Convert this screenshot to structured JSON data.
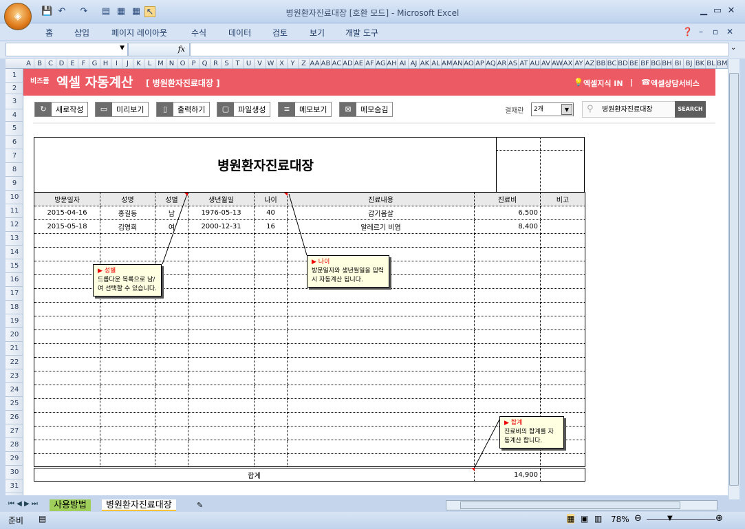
{
  "window": {
    "title": "병원환자진료대장  [호환 모드] - Microsoft Excel"
  },
  "ribbon": {
    "tabs": [
      "홈",
      "삽입",
      "페이지 레이아웃",
      "수식",
      "데이터",
      "검토",
      "보기",
      "개발 도구"
    ]
  },
  "formula": {
    "fx": "fx"
  },
  "columns": [
    "A",
    "B",
    "C",
    "D",
    "E",
    "F",
    "G",
    "H",
    "I",
    "J",
    "K",
    "L",
    "M",
    "N",
    "O",
    "P",
    "Q",
    "R",
    "S",
    "T",
    "U",
    "V",
    "W",
    "X",
    "Y",
    "Z",
    "AA",
    "AB",
    "AC",
    "AD",
    "AE",
    "AF",
    "AG",
    "AH",
    "AI",
    "AJ",
    "AK",
    "AL",
    "AM",
    "AN",
    "AO",
    "AP",
    "AQ",
    "AR",
    "AS",
    "AT",
    "AU",
    "AV",
    "AW",
    "AX",
    "AY",
    "AZ",
    "BB",
    "BC",
    "BD",
    "BE",
    "BF",
    "BG",
    "BH",
    "BI",
    "BJ",
    "BK",
    "BL",
    "BM"
  ],
  "rows": [
    "1",
    "2",
    "3",
    "4",
    "5",
    "6",
    "7",
    "8",
    "9",
    "10",
    "11",
    "12",
    "13",
    "14",
    "15",
    "16",
    "17",
    "18",
    "19",
    "20",
    "21",
    "22",
    "23",
    "24",
    "25",
    "26",
    "27",
    "28",
    "29",
    "30",
    "31"
  ],
  "banner": {
    "brand_small": "비즈폼",
    "brand": "엑셀 자동계산",
    "subtitle": "[ 병원환자진료대장 ]",
    "link1": "엑셀지식 IN",
    "divider": "|",
    "link2": "엑셀상담서비스",
    "color": "#ec5a63"
  },
  "toolbar": {
    "buttons": [
      "새로작성",
      "미리보기",
      "출력하기",
      "파일생성",
      "메모보기",
      "메모숨김"
    ],
    "approval_label": "결재란",
    "approval_value": "2개",
    "search_value": "병원환자진료대장",
    "search_button": "SEARCH"
  },
  "document": {
    "title": "병원환자진료대장",
    "headers": [
      "방문일자",
      "성명",
      "성별",
      "생년월일",
      "나이",
      "진료내용",
      "진료비",
      "비고"
    ],
    "records": [
      [
        "2015-04-16",
        "홍길동",
        "남",
        "1976-05-13",
        "40",
        "감기몸살",
        "6,500",
        ""
      ],
      [
        "2015-05-18",
        "김영희",
        "여",
        "2000-12-31",
        "16",
        "알레르기 비염",
        "8,400",
        ""
      ]
    ],
    "total_label": "합계",
    "total_value": "14,900"
  },
  "memos": [
    {
      "title": "성별",
      "body": "드롭다운 목록으로 남/여 선택할 수 있습니다."
    },
    {
      "title": "나이",
      "body": "방문일자와 생년월일을 입력시 자동계산 됩니다."
    },
    {
      "title": "합계",
      "body": "진료비의 합계를 자동계산 합니다."
    }
  ],
  "sheet_tabs": [
    "사용방법",
    "병원환자진료대장"
  ],
  "status": {
    "ready": "준비",
    "zoom": "78%"
  }
}
